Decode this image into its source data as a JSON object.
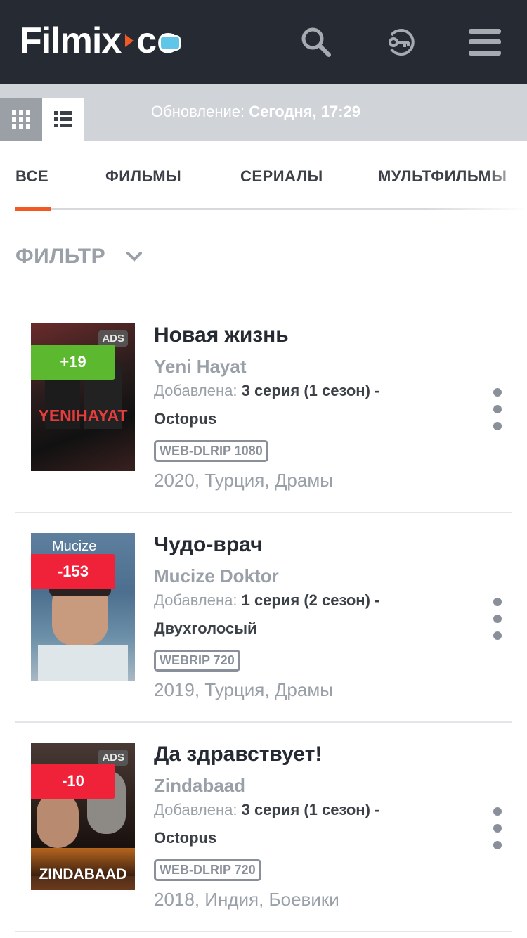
{
  "header": {
    "logo": {
      "name": "Filmix",
      "domain": "co"
    },
    "icons": [
      "search-icon",
      "login-key-icon",
      "menu-icon"
    ]
  },
  "toolbar": {
    "update_label": "Обновление:",
    "update_value": "Сегодня, 17:29",
    "view_modes": [
      "grid-view-icon",
      "list-view-icon"
    ],
    "active_view": "list"
  },
  "tabs": [
    {
      "label": "ВСЕ",
      "active": true
    },
    {
      "label": "ФИЛЬМЫ",
      "active": false
    },
    {
      "label": "СЕРИАЛЫ",
      "active": false
    },
    {
      "label": "МУЛЬТФИЛЬМЫ",
      "active": false
    }
  ],
  "filter": {
    "label": "ФИЛЬТР"
  },
  "items": [
    {
      "title": "Новая жизнь",
      "original_title": "Yeni Hayat",
      "added_label": "Добавлена:",
      "added_value": "3 серия (1 сезон) - Octopus",
      "quality": "WEB-DLRIP 1080",
      "meta": "2020, Турция, Драмы",
      "rating": "+19",
      "rating_color": "#5cb82e",
      "ads": "ADS",
      "poster_text": "YENIHAYAT"
    },
    {
      "title": "Чудо-врач",
      "original_title": "Mucize Doktor",
      "added_label": "Добавлена:",
      "added_value": "1 серия (2 сезон) - Двухголосый",
      "quality": "WEBRIP 720",
      "meta": "2019, Турция, Драмы",
      "rating": "-153",
      "rating_color": "#f0223a",
      "ads": "",
      "poster_text": "Mucize"
    },
    {
      "title": "Да здравствует!",
      "original_title": "Zindabaad",
      "added_label": "Добавлена:",
      "added_value": "3 серия (1 сезон) - Octopus",
      "quality": "WEB-DLRIP 720",
      "meta": "2018, Индия, Боевики",
      "rating": "-10",
      "rating_color": "#f0223a",
      "ads": "ADS",
      "poster_text": "ZINDABAAD"
    }
  ],
  "colors": {
    "header_bg": "#262a33",
    "accent": "#f15a24",
    "muted": "#9aa0a8"
  }
}
